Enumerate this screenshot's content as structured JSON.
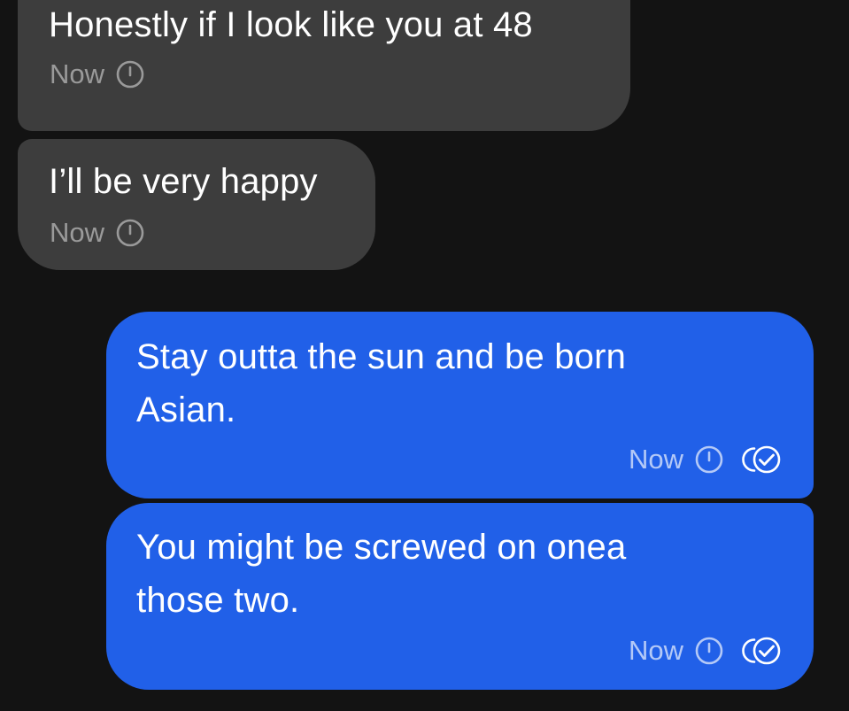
{
  "thread": {
    "messages": [
      {
        "direction": "incoming",
        "text": "Honestly if I look like you at 48",
        "time": "Now",
        "status_icon": "clock-icon"
      },
      {
        "direction": "incoming",
        "text": "I’ll be very happy",
        "time": "Now",
        "status_icon": "clock-icon"
      },
      {
        "direction": "outgoing",
        "text": "Stay outta the sun and be born\nAsian.",
        "time": "Now",
        "status_icon": "clock-icon",
        "receipt_icon": "read-receipt-icon"
      },
      {
        "direction": "outgoing",
        "text": "You might be screwed on onea\nthose two.",
        "time": "Now",
        "status_icon": "clock-icon",
        "receipt_icon": "read-receipt-icon"
      }
    ]
  },
  "colors": {
    "background": "#131313",
    "incoming_bubble": "#3d3d3d",
    "outgoing_bubble": "#2160e8",
    "text": "#ffffff"
  }
}
